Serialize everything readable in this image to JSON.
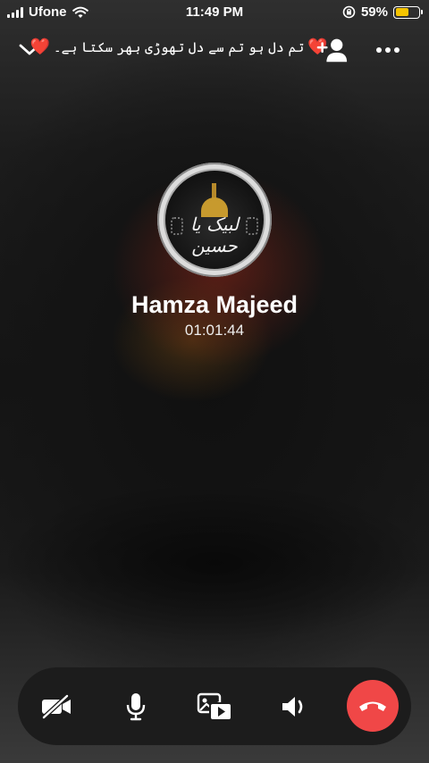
{
  "status_bar": {
    "carrier": "Ufone",
    "time": "11:49 PM",
    "battery_percent": "59%",
    "battery_level": 0.59,
    "battery_color": "#f5c400"
  },
  "header": {
    "title": "تم دل ہو تم سے دل تھوڑی بھر سکتا ہے۔",
    "heart_left": "❤️",
    "heart_right": "❤️",
    "icons": [
      "chevron-down-icon",
      "add-person-icon",
      "more-icon"
    ]
  },
  "caller": {
    "name": "Hamza Majeed",
    "duration": "01:01:44",
    "avatar_text": "لبیک یا حسین"
  },
  "controls": {
    "buttons": [
      "video-off-icon",
      "microphone-icon",
      "media-share-icon",
      "speaker-icon",
      "end-call-icon"
    ],
    "end_call_color": "#f04747"
  }
}
